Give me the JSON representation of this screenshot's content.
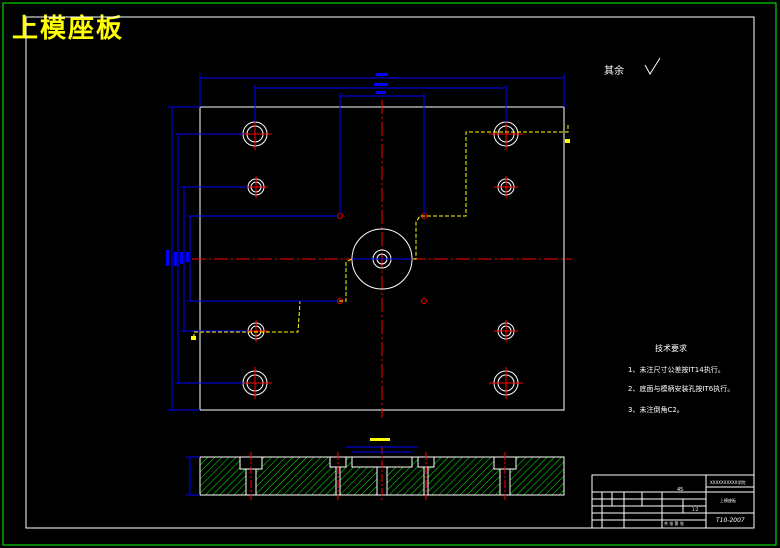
{
  "drawing_title": "上模座板",
  "roughness_note": {
    "label": "其余"
  },
  "tech_requirements": {
    "heading": "技术要求",
    "items": [
      "1、未注尺寸公差按IT14执行。",
      "2、底面与模柄安装孔按IT6执行。",
      "3、未注倒角C2。"
    ]
  },
  "title_block": {
    "company": "XXXXXXXXXX学院",
    "part_name": "上模座板",
    "drawing_no": "T10-2007",
    "scale": "1:2",
    "material": "45",
    "sheet": "共  张 第  张"
  },
  "colors": {
    "background": "#000000",
    "frame": "#ffffff",
    "outline": "#ffffff",
    "dimension": "#0000ff",
    "centerline": "#ff0000",
    "hidden": "#ffff00",
    "hatch": "#00ff00",
    "title": "#ffff00"
  }
}
